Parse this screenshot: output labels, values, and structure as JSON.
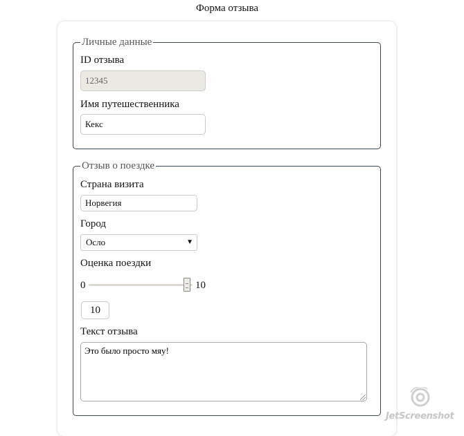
{
  "page": {
    "title": "Форма отзыва"
  },
  "personal": {
    "legend": "Личные данные",
    "id_label": "ID отзыва",
    "id_value": "12345",
    "name_label": "Имя путешественника",
    "name_value": "Кекс"
  },
  "trip": {
    "legend": "Отзыв о поездке",
    "country_label": "Страна визита",
    "country_value": "Норвегия",
    "city_label": "Город",
    "city_value": "Осло",
    "rating_label": "Оценка поездки",
    "rating_min": "0",
    "rating_max": "10",
    "rating_value": 10,
    "rating_display": "10",
    "review_label": "Текст отзыва",
    "review_value": "Это было просто мяу!"
  },
  "watermark": {
    "text": "JetScreenshot",
    "icon": "camera-lens-icon"
  },
  "colors": {
    "fieldset_border": "#3a4651",
    "readonly_bg": "#ebe9e3",
    "legend_text": "#555555"
  }
}
